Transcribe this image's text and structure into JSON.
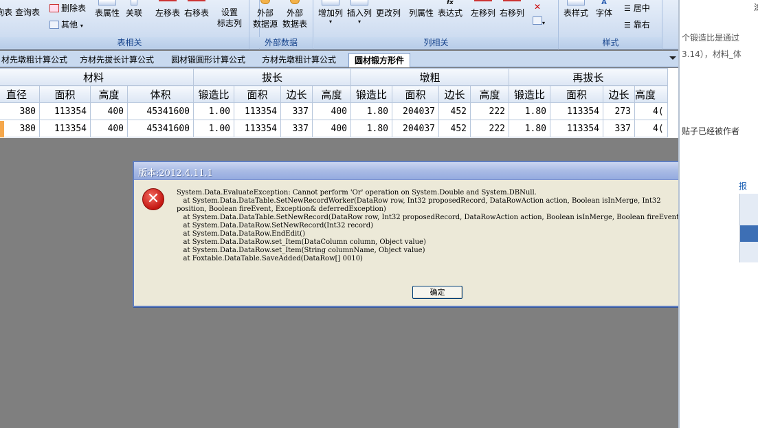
{
  "ribbon": {
    "groups": [
      {
        "label": "表相关"
      },
      {
        "label": "外部数据"
      },
      {
        "label": "列相关"
      },
      {
        "label": "样式"
      }
    ],
    "buttons": {
      "table_partial": "询表",
      "query_table": "查询表",
      "delete_table": "删除表",
      "other": "其他",
      "table_props": "表属性",
      "join": "关联",
      "move_left_table": "左移表",
      "move_right_table": "右移表",
      "setup_flag_col_1": "设置",
      "setup_flag_col_2": "标志列",
      "ext_source_1": "外部",
      "ext_source_2": "数据源",
      "ext_table_1": "外部",
      "ext_table_2": "数据表",
      "add_col": "增加列",
      "insert_col": "插入列",
      "rename_col": "更改列",
      "col_props": "列属性",
      "expression": "表达式",
      "move_left_col": "左移列",
      "move_right_col": "右移列",
      "table_style": "表样式",
      "font": "字体",
      "center": "居中",
      "align_right": "靠右"
    }
  },
  "tabs": [
    {
      "label": "材先墩粗计算公式"
    },
    {
      "label": "方材先拔长计算公式"
    },
    {
      "label": "圆材锻圆形计算公式"
    },
    {
      "label": "方材先墩粗计算公式"
    },
    {
      "label": "圆材锻方形件"
    }
  ],
  "grid": {
    "group_headers": [
      "材料",
      "拔长",
      "墩粗",
      "再拔长"
    ],
    "columns": [
      "直径",
      "面积",
      "高度",
      "体积",
      "锻造比",
      "面积",
      "边长",
      "高度",
      "锻造比",
      "面积",
      "边长",
      "高度",
      "锻造比",
      "面积",
      "边长",
      "高度"
    ],
    "rows": [
      [
        "380",
        "113354",
        "400",
        "45341600",
        "1.00",
        "113354",
        "337",
        "400",
        "1.80",
        "204037",
        "452",
        "222",
        "1.80",
        "113354",
        "273",
        "4("
      ],
      [
        "380",
        "113354",
        "400",
        "45341600",
        "1.00",
        "113354",
        "337",
        "400",
        "1.80",
        "204037",
        "452",
        "222",
        "1.80",
        "113354",
        "337",
        "4("
      ]
    ]
  },
  "dialog": {
    "title": "版本:2012.4.11.1",
    "message": "System.Data.EvaluateException: Cannot perform 'Or' operation on System.Double and System.DBNull.\n   at System.Data.DataTable.SetNewRecordWorker(DataRow row, Int32 proposedRecord, DataRowAction action, Boolean isInMerge, Int32\nposition, Boolean fireEvent, Exception& deferredException)\n   at System.Data.DataTable.SetNewRecord(DataRow row, Int32 proposedRecord, DataRowAction action, Boolean isInMerge, Boolean fireEvent)\n   at System.Data.DataRow.SetNewRecord(Int32 record)\n   at System.Data.DataRow.EndEdit()\n   at System.Data.DataRow.set_Item(DataColumn column, Object value)\n   at System.Data.DataRow.set_Item(String columnName, Object value)\n   at Foxtable.DataTable.SaveAdded(DataRow[] 0010)",
    "ok_label": "确定",
    "close_glyph": "✕",
    "error_glyph": "✕"
  },
  "right_panel": {
    "line1": "个锻造比是通过",
    "line2": "3.14），材料_体",
    "line3": "贴子已经被作者",
    "top_clip": "渝",
    "side_clip": "报"
  }
}
